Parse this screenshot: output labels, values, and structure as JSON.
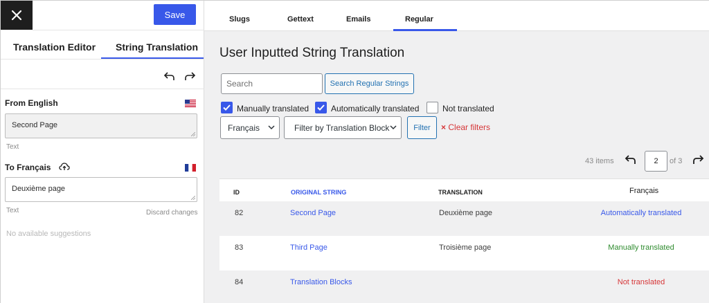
{
  "left_panel": {
    "save_label": "Save",
    "tabs": [
      {
        "label": "Translation Editor"
      },
      {
        "label": "String Translation"
      }
    ],
    "from_label": "From English",
    "source_text": "Second Page",
    "source_type": "Text",
    "to_label": "To Français",
    "translation_text": "Deuxième page",
    "translation_type": "Text",
    "discard_label": "Discard changes",
    "suggestions_text": "No available suggestions"
  },
  "top_tabs": [
    {
      "label": "Slugs"
    },
    {
      "label": "Gettext"
    },
    {
      "label": "Emails"
    },
    {
      "label": "Regular"
    }
  ],
  "active_top_tab": "Regular",
  "page_title": "User Inputted String Translation",
  "search": {
    "placeholder": "Search",
    "button_label": "Search Regular Strings"
  },
  "filters": {
    "checkboxes": [
      {
        "label": "Manually translated",
        "checked": true
      },
      {
        "label": "Automatically translated",
        "checked": true
      },
      {
        "label": "Not translated",
        "checked": false
      }
    ],
    "language_select": "Français",
    "block_select": "Filter by Translation Block",
    "filter_button": "Filter",
    "clear_label": "Clear filters",
    "clear_icon": "×"
  },
  "pagination": {
    "items_label": "43 items",
    "current_page": "2",
    "of_label": "of 3"
  },
  "table": {
    "headers": {
      "id": "ID",
      "original": "ORIGINAL STRING",
      "translation": "TRANSLATION",
      "language": "Français"
    },
    "rows": [
      {
        "id": "82",
        "original": "Second Page",
        "translation": "Deuxième page",
        "status": "Automatically translated"
      },
      {
        "id": "83",
        "original": "Third Page",
        "translation": "Troisième page",
        "status": "Manually translated"
      },
      {
        "id": "84",
        "original": "Translation Blocks",
        "translation": "",
        "status": "Not translated"
      }
    ]
  },
  "colors": {
    "accent": "#3858e9",
    "auto_status": "#3858e9",
    "manual_status": "#2e8b2e",
    "not_status": "#d63638"
  },
  "icons": {
    "close": "close-icon",
    "undo": "undo-icon",
    "redo": "redo-icon",
    "us_flag": "us-flag-icon",
    "fr_flag": "fr-flag-icon",
    "cloud": "cloud-upload-icon",
    "check": "check-icon",
    "chevron": "chevron-down-icon"
  }
}
